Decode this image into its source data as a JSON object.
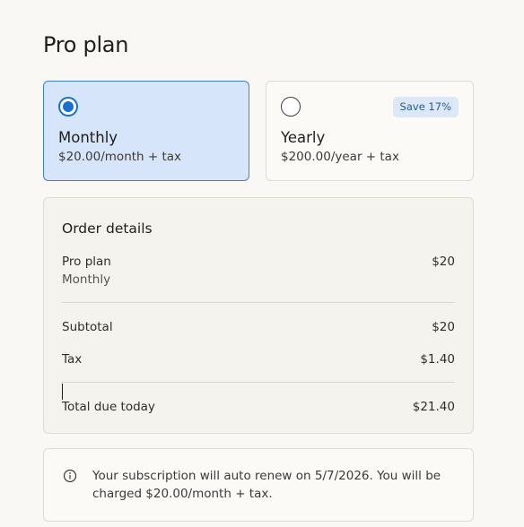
{
  "page": {
    "title": "Pro plan"
  },
  "plans": [
    {
      "name": "Monthly",
      "price": "$20.00/month + tax",
      "selected": true
    },
    {
      "name": "Yearly",
      "price": "$200.00/year + tax",
      "badge": "Save 17%",
      "selected": false
    }
  ],
  "order": {
    "title": "Order details",
    "item_label": "Pro plan",
    "item_sub": "Monthly",
    "item_value": "$20",
    "subtotal_label": "Subtotal",
    "subtotal_value": "$20",
    "tax_label": "Tax",
    "tax_value": "$1.40",
    "total_label": "Total due today",
    "total_value": "$21.40"
  },
  "notice": {
    "icon": "info-icon",
    "text": "Your subscription will auto renew on 5/7/2026. You will be charged $20.00/month + tax."
  },
  "colors": {
    "accent": "#1a6fd0",
    "selected_bg": "#d6e5fa",
    "badge_text": "#245aa0",
    "page_bg": "#f9f8f4"
  }
}
